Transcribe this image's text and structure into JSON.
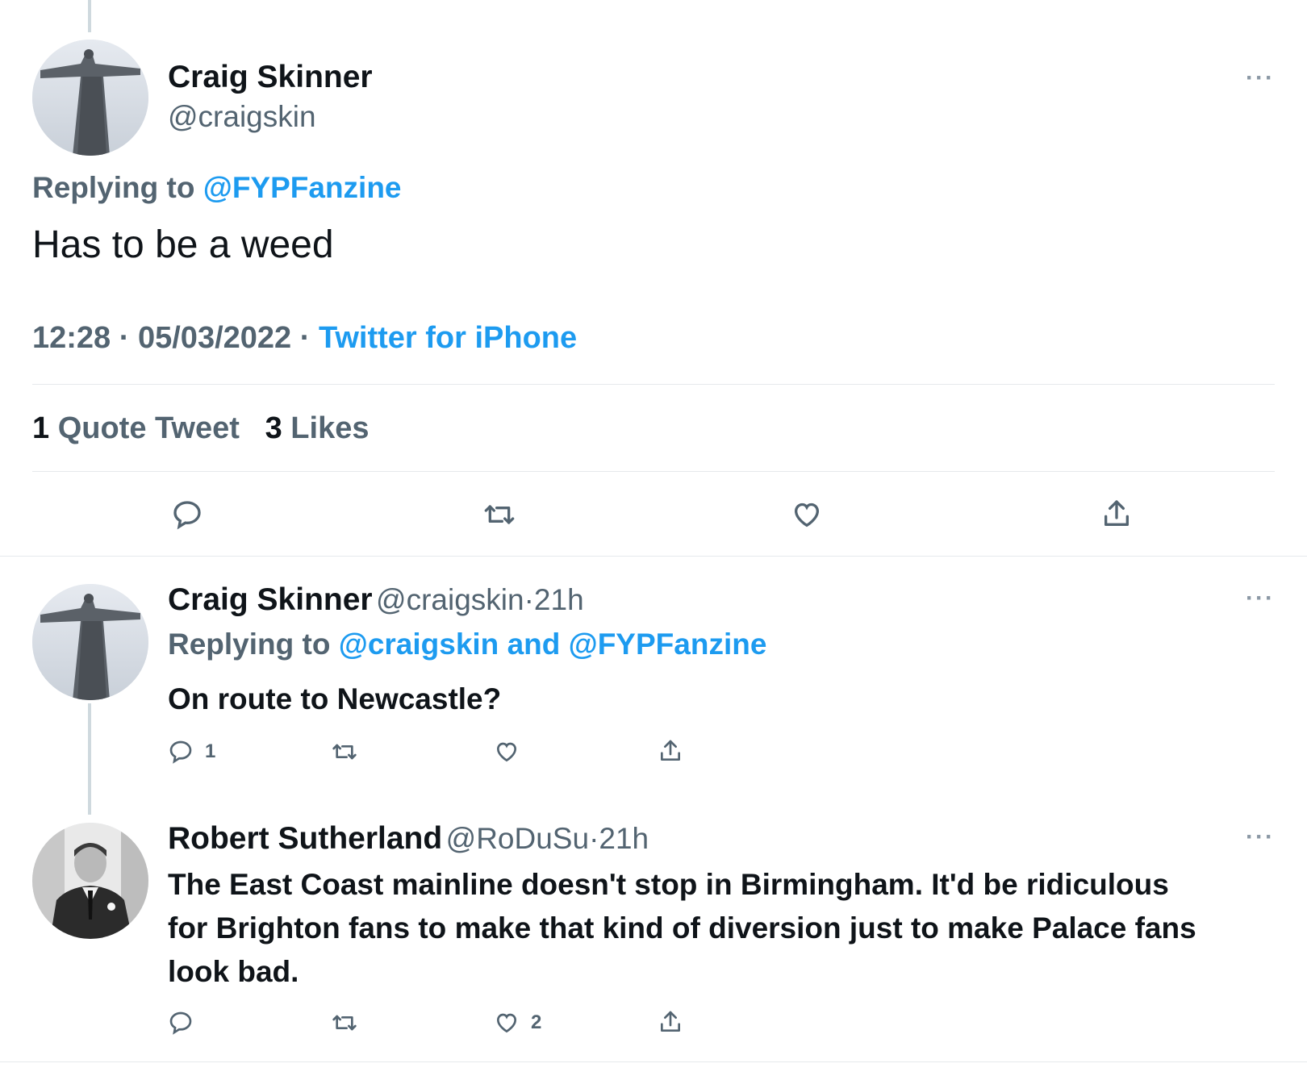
{
  "main_tweet": {
    "author_name": "Craig Skinner",
    "author_handle": "@craigskin",
    "replying_prefix": "Replying to",
    "replying_to": "@FYPFanzine",
    "text": "Has to be a weed",
    "time": "12:28",
    "date": "05/03/2022",
    "source": "Twitter for iPhone",
    "quote_count": "1",
    "quote_label": "Quote Tweet",
    "like_count": "3",
    "like_label": "Likes",
    "more": "···"
  },
  "replies": [
    {
      "author_name": "Craig Skinner",
      "author_handle": "@craigskin",
      "age": "21h",
      "replying_prefix": "Replying to",
      "replying_to": "@craigskin and @FYPFanzine",
      "text": "On route to Newcastle?",
      "reply_count": "1",
      "like_count": "",
      "more": "···"
    },
    {
      "author_name": "Robert Sutherland",
      "author_handle": "@RoDuSu",
      "age": "21h",
      "text_lines": [
        "The East Coast mainline doesn't stop in Birmingham. It'd be ridiculous",
        "for Brighton fans to make that kind of diversion just to make Palace fans",
        "look bad."
      ],
      "reply_count": "",
      "like_count": "2",
      "more": "···"
    }
  ],
  "separator": "·",
  "icons": [
    "reply-icon",
    "retweet-icon",
    "like-icon",
    "share-icon",
    "more-icon"
  ],
  "colors": {
    "link": "#1d9bf0",
    "muted": "#536471",
    "text": "#0f1419",
    "divider": "#e6e9ec"
  }
}
